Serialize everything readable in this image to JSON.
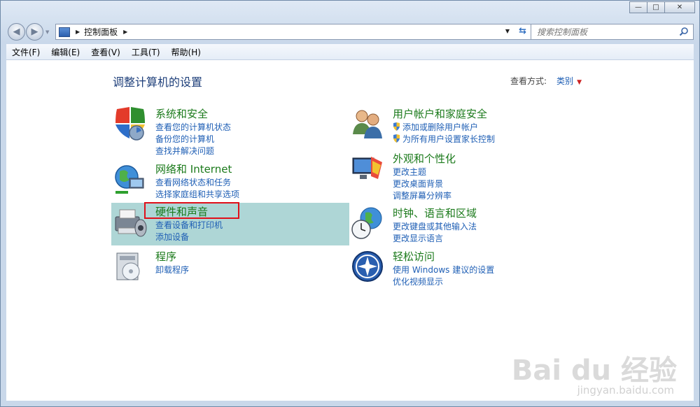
{
  "window": {
    "controls": {
      "minimize": "—",
      "maximize": "□",
      "close": "✕"
    }
  },
  "nav": {
    "breadcrumb": "控制面板",
    "search_placeholder": "搜索控制面板"
  },
  "menu": [
    "文件(F)",
    "编辑(E)",
    "查看(V)",
    "工具(T)",
    "帮助(H)"
  ],
  "header": {
    "title": "调整计算机的设置",
    "view_by_label": "查看方式:",
    "view_by_value": "类别"
  },
  "categories": [
    {
      "title": "系统和安全",
      "links": [
        "查看您的计算机状态",
        "备份您的计算机",
        "查找并解决问题"
      ]
    },
    {
      "title": "网络和 Internet",
      "links": [
        "查看网络状态和任务",
        "选择家庭组和共享选项"
      ]
    },
    {
      "title": "硬件和声音",
      "links": [
        "查看设备和打印机",
        "添加设备"
      ]
    },
    {
      "title": "程序",
      "links": [
        "卸载程序"
      ]
    },
    {
      "title": "用户帐户和家庭安全",
      "links": [
        "添加或删除用户帐户",
        "为所有用户设置家长控制"
      ]
    },
    {
      "title": "外观和个性化",
      "links": [
        "更改主题",
        "更改桌面背景",
        "调整屏幕分辨率"
      ]
    },
    {
      "title": "时钟、语言和区域",
      "links": [
        "更改键盘或其他输入法",
        "更改显示语言"
      ]
    },
    {
      "title": "轻松访问",
      "links": [
        "使用 Windows 建议的设置",
        "优化视频显示"
      ]
    }
  ],
  "watermark": {
    "brand": "Bai du 经验",
    "url": "jingyan.baidu.com"
  },
  "colors": {
    "title_green": "#1b7a1b",
    "link_blue": "#1f5fb5",
    "highlight": "#aed6d6",
    "annotation_red": "#e0101a"
  }
}
